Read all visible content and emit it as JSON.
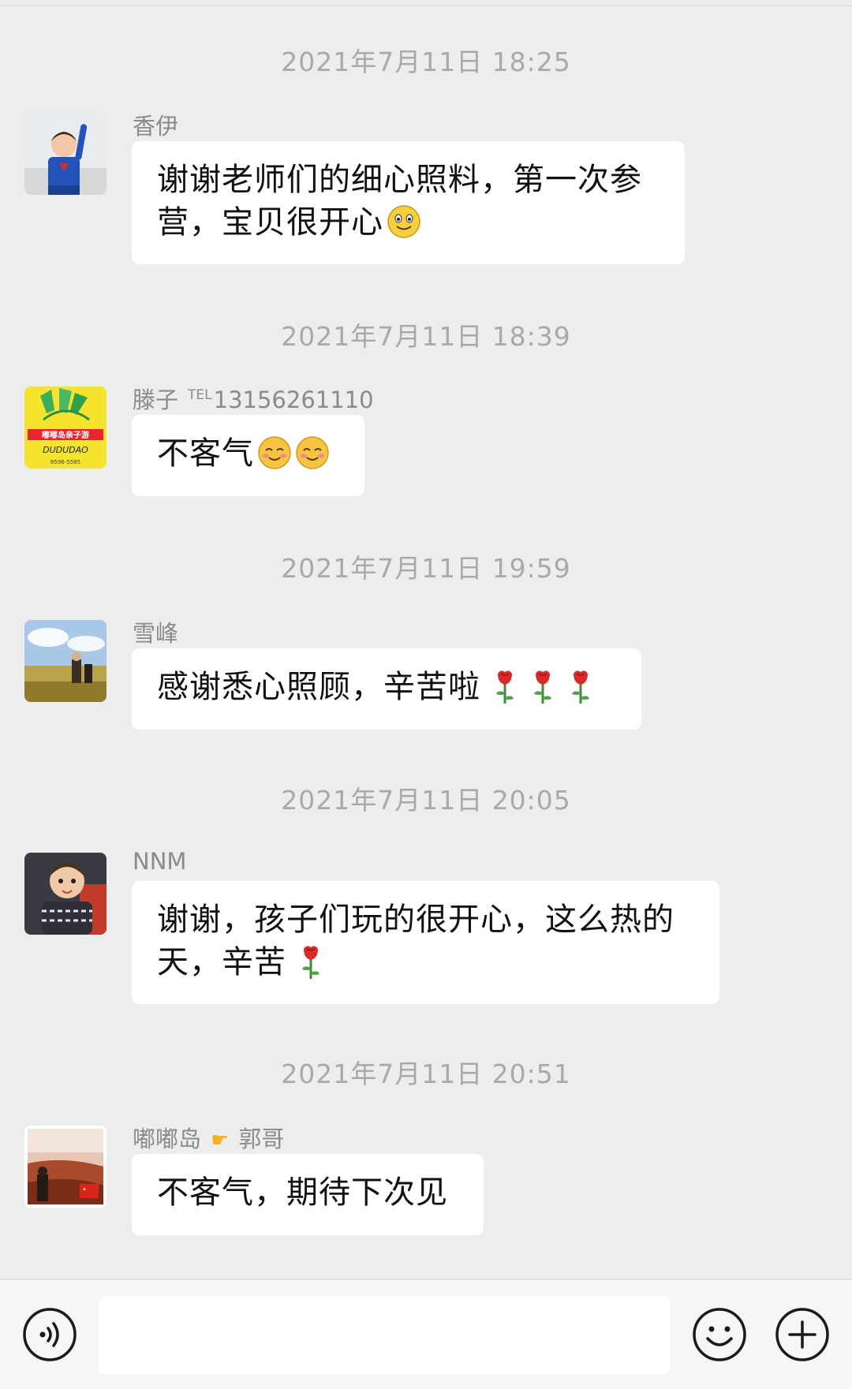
{
  "chat": {
    "messages": [
      {
        "timestamp": "2021年7月11日 18:25",
        "sender": "香伊",
        "lines": [
          "谢谢老师们的细心照料，第一次参",
          "营，宝贝很开心"
        ],
        "trailing_emoji": "smile-emoji"
      },
      {
        "timestamp": "2021年7月11日 18:39",
        "sender": "滕子",
        "sender_tel_label": "TEL",
        "sender_tel": "13156261110",
        "text": "不客气",
        "trailing_emoji": "blush-emoji x2"
      },
      {
        "timestamp": "2021年7月11日 19:59",
        "sender": "雪峰",
        "text": "感谢悉心照顾，辛苦啦",
        "trailing_emoji": "rose-emoji x3"
      },
      {
        "timestamp": "2021年7月11日 20:05",
        "sender": "NNM",
        "lines": [
          "谢谢，孩子们玩的很开心，这么热的",
          "天，辛苦"
        ],
        "trailing_emoji": "rose-emoji"
      },
      {
        "timestamp": "2021年7月11日 20:51",
        "sender_part1": "嘟嘟岛",
        "sender_part2": "郭哥",
        "sender_emoji": "pointing-right-emoji",
        "text": "不客气，期待下次见"
      }
    ]
  },
  "avatar_logo": {
    "line1": "嘟嘟岛亲子游",
    "line2": "DUDUDAO",
    "line3": "8596-5585"
  },
  "input_bar": {
    "voice_icon": "voice-icon",
    "emoji_icon": "emoji-icon",
    "plus_icon": "plus-icon",
    "text_value": ""
  },
  "colors": {
    "background": "#ededed",
    "bubble": "#ffffff",
    "timestamp": "#a9a9a9",
    "sender": "#8a8a8a"
  }
}
